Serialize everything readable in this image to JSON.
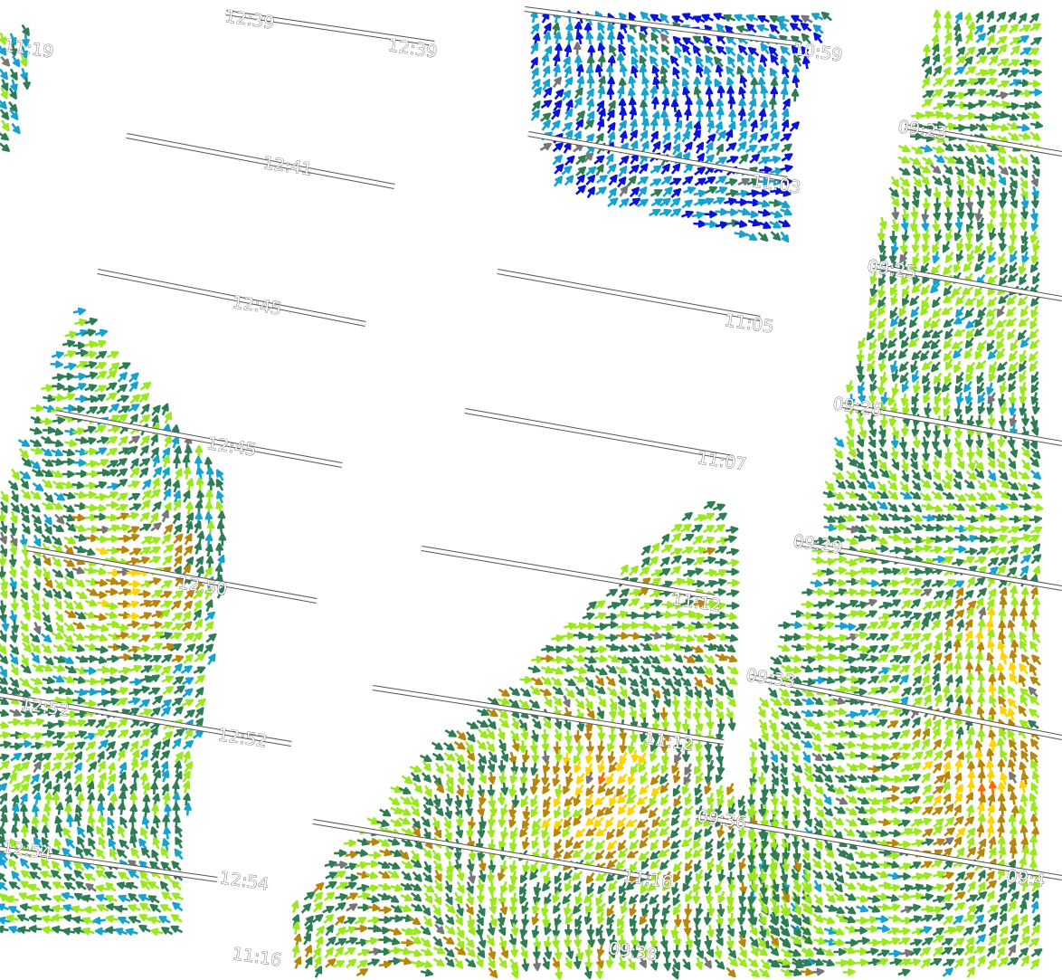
{
  "map": {
    "type": "scatterometer wind vector swaths",
    "arrow_color_scale": [
      "#0a14d8",
      "#17a3cf",
      "#2e7d55",
      "#9be81e",
      "#b8860b",
      "#ffd400",
      "#ff6a00",
      "#777777"
    ],
    "track_colors": {
      "fill": "#ffffff",
      "outline": "#555555"
    },
    "time_labels": [
      "12:39",
      "12:39",
      "12:41",
      "12:45",
      "12:45",
      "12:50",
      "12:52",
      "12:52",
      "12:54",
      "12:54",
      "11:19",
      "10:59",
      "11:03",
      "11:05",
      "11:07",
      "11:12",
      "11:12",
      "11:16",
      "11:16",
      "09:23",
      "09:25",
      "09:28",
      "09:29",
      "09:33",
      "09:36",
      "09:38",
      "09:4"
    ]
  }
}
